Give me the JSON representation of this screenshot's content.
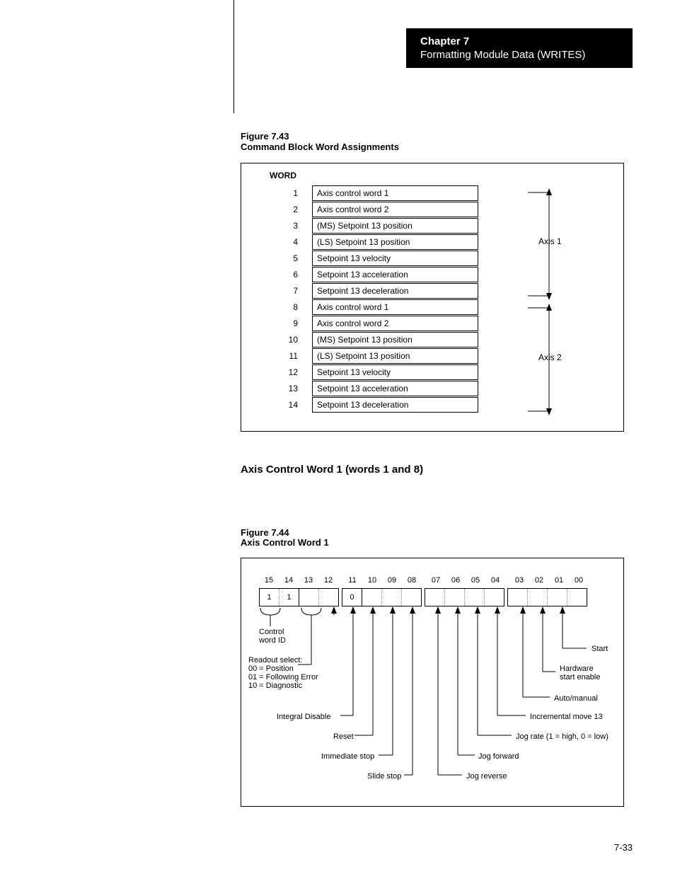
{
  "chapter": {
    "title": "Chapter 7",
    "subtitle": "Formatting Module Data (WRITES)"
  },
  "figure43": {
    "num": "Figure 7.43",
    "title": "Command Block Word Assignments",
    "header": "WORD"
  },
  "words": [
    {
      "n": "1",
      "d": "Axis control word 1"
    },
    {
      "n": "2",
      "d": "Axis control word 2"
    },
    {
      "n": "3",
      "d": "(MS) Setpoint 13 position"
    },
    {
      "n": "4",
      "d": "(LS) Setpoint 13 position"
    },
    {
      "n": "5",
      "d": "Setpoint 13 velocity"
    },
    {
      "n": "6",
      "d": "Setpoint 13 acceleration"
    },
    {
      "n": "7",
      "d": "Setpoint 13 deceleration"
    },
    {
      "n": "8",
      "d": "Axis control word 1"
    },
    {
      "n": "9",
      "d": "Axis control word 2"
    },
    {
      "n": "10",
      "d": "(MS) Setpoint 13 position"
    },
    {
      "n": "11",
      "d": "(LS) Setpoint 13 position"
    },
    {
      "n": "12",
      "d": "Setpoint 13 velocity"
    },
    {
      "n": "13",
      "d": "Setpoint 13 acceleration"
    },
    {
      "n": "14",
      "d": "Setpoint 13 deceleration"
    }
  ],
  "axis1": "Axis 1",
  "axis2": "Axis 2",
  "section_heading": "Axis Control Word 1 (words 1 and 8)",
  "figure44": {
    "num": "Figure 7.44",
    "title": "Axis Control Word 1"
  },
  "bits": [
    "15",
    "14",
    "13",
    "12",
    "11",
    "10",
    "09",
    "08",
    "07",
    "06",
    "05",
    "04",
    "03",
    "02",
    "01",
    "00"
  ],
  "bitvals": {
    "b15": "1",
    "b14": "1",
    "b11": "0"
  },
  "labels": {
    "control_word_id": "Control\nword ID",
    "readout_select": "Readout select:\n00 = Position\n01 = Following Error\n10 = Diagnostic",
    "integral_disable": "Integral Disable",
    "reset": "Reset",
    "immediate_stop": "Immediate stop",
    "slide_stop": "Slide stop",
    "jog_reverse": "Jog reverse",
    "jog_forward": "Jog forward",
    "jog_rate": "Jog rate (1 = high, 0 = low)",
    "incremental_move": "Incremental move 13",
    "auto_manual": "Auto/manual",
    "hw_start_enable": "Hardware\nstart enable",
    "start": "Start"
  },
  "pagenum": "7-33"
}
